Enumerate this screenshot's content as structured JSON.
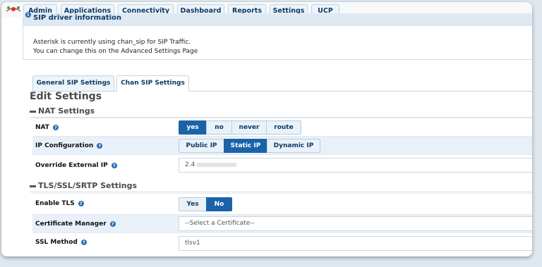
{
  "nav": {
    "tabs": [
      "Admin",
      "Applications",
      "Connectivity",
      "Dashboard",
      "Reports",
      "Settings",
      "UCP"
    ]
  },
  "info": {
    "title": "SIP driver information",
    "line1": "Asterisk is currently using chan_sip for SIP Traffic.",
    "line2": "You can change this on the Advanced Settings Page"
  },
  "tabs": {
    "general": "General SIP Settings",
    "chan": "Chan SIP Settings",
    "active": "Chan SIP Settings"
  },
  "edit": {
    "title": "Edit Settings"
  },
  "nat_section": {
    "title": "NAT Settings",
    "nat": {
      "label": "NAT",
      "options": [
        "yes",
        "no",
        "never",
        "route"
      ],
      "selected": "yes"
    },
    "ip_config": {
      "label": "IP Configuration",
      "options": [
        "Public IP",
        "Static IP",
        "Dynamic IP"
      ],
      "selected": "Static IP"
    },
    "override": {
      "label": "Override External IP",
      "value": "2.4"
    }
  },
  "tls_section": {
    "title": "TLS/SSL/SRTP Settings",
    "enable_tls": {
      "label": "Enable TLS",
      "options": [
        "Yes",
        "No"
      ],
      "selected": "No"
    },
    "cert_manager": {
      "label": "Certificate Manager",
      "value": "--Select a Certificate--"
    },
    "ssl_method": {
      "label": "SSL Method",
      "value": "tlsv1"
    }
  },
  "colors": {
    "accent": "#1a63a8",
    "alt_row": "#e8f1f9",
    "nav_text": "#0b3a66"
  }
}
